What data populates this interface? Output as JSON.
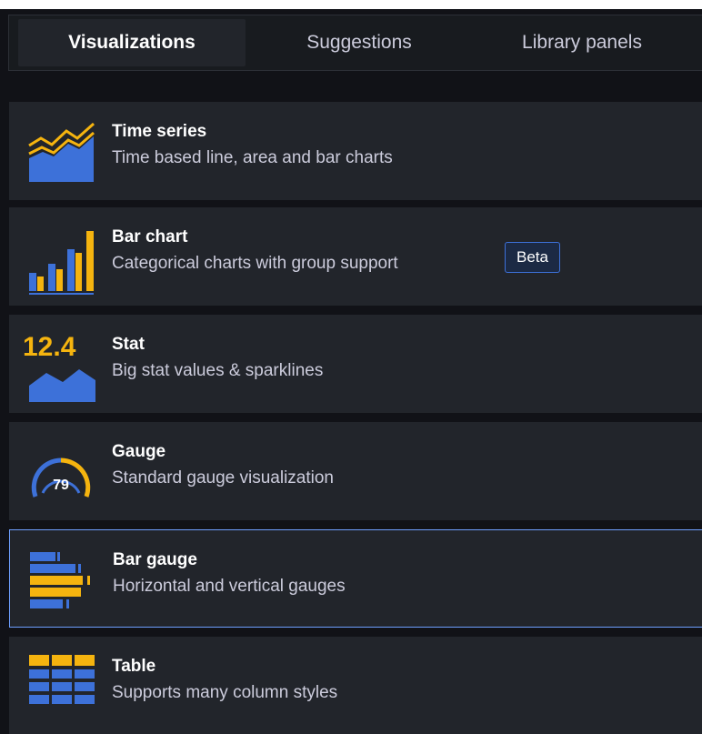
{
  "tabs": [
    {
      "label": "Visualizations",
      "active": true
    },
    {
      "label": "Suggestions",
      "active": false
    },
    {
      "label": "Library panels",
      "active": false
    }
  ],
  "cards": [
    {
      "title": "Time series",
      "description": "Time based line, area and bar charts",
      "icon": "time-series-icon"
    },
    {
      "title": "Bar chart",
      "description": "Categorical charts with group support",
      "badge": "Beta",
      "icon": "bar-chart-icon"
    },
    {
      "title": "Stat",
      "description": "Big stat values & sparklines",
      "icon": "stat-icon",
      "icon_value": "12.4"
    },
    {
      "title": "Gauge",
      "description": "Standard gauge visualization",
      "icon": "gauge-icon",
      "icon_value": "79"
    },
    {
      "title": "Bar gauge",
      "description": "Horizontal and vertical gauges",
      "icon": "bar-gauge-icon",
      "selected": true
    },
    {
      "title": "Table",
      "description": "Supports many column styles",
      "icon": "table-icon"
    }
  ],
  "colors": {
    "accent_blue": "#3d71d9",
    "accent_yellow": "#f5b40f",
    "selected_border": "#6e9fff"
  }
}
